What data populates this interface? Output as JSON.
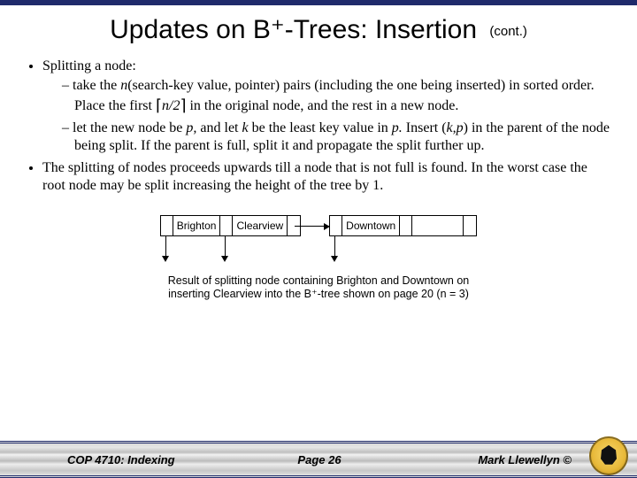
{
  "title": {
    "main": "Updates on B⁺-Trees:  Insertion",
    "cont": "(cont.)"
  },
  "bullets": {
    "b1": "Splitting a node:",
    "b1a_pre": "take the ",
    "b1a_n": "n",
    "b1a_mid1": "(search-key value, pointer) pairs (including the one being inserted) in sorted order.  Place the first ",
    "b1a_ceil": "n/2",
    "b1a_mid2": " in the original node, and the rest in a new node.",
    "b1b_pre": "let the new node be ",
    "b1b_p": "p,",
    "b1b_mid1": " and let ",
    "b1b_k": "k",
    "b1b_mid2": " be the least key value in ",
    "b1b_p2": "p.",
    "b1b_mid3": "  Insert (",
    "b1b_kp": "k,p",
    "b1b_mid4": ") in the parent of the node being split. If the parent is full, split it and propagate the split further up.",
    "b2": "The splitting of nodes proceeds upwards till a node that is not full is found.  In the worst case the root node may be split increasing the height of the tree by 1."
  },
  "diagram": {
    "left_keys": [
      "Brighton",
      "Clearview"
    ],
    "right_keys": [
      "Downtown"
    ]
  },
  "caption": {
    "l1": "Result of splitting node containing Brighton and Downtown on",
    "l2": "inserting Clearview into the B⁺-tree shown on page 20 (n = 3)"
  },
  "footer": {
    "left": "COP 4710: Indexing",
    "mid": "Page 26",
    "right": "Mark Llewellyn ©"
  }
}
